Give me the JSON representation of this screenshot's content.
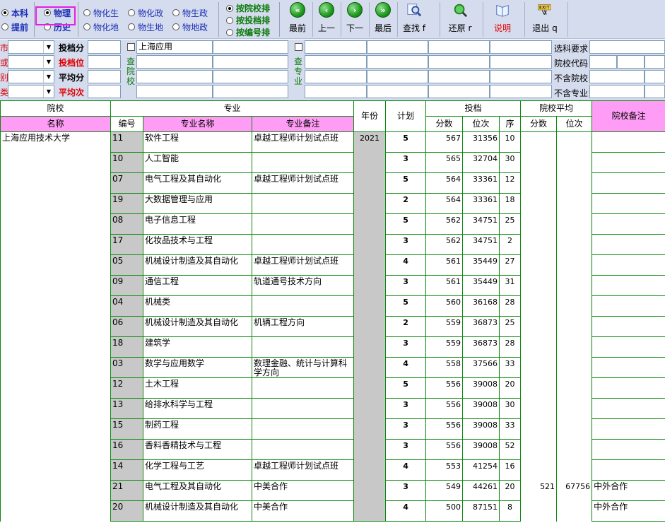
{
  "toolbar": {
    "batch": [
      {
        "label": "本科",
        "checked": true
      },
      {
        "label": "提前",
        "checked": false
      }
    ],
    "subject": [
      {
        "label": "物理",
        "checked": true
      },
      {
        "label": "历史",
        "checked": false
      }
    ],
    "combos": [
      {
        "label": "物化生",
        "checked": false
      },
      {
        "label": "物化地",
        "checked": false
      },
      {
        "label": "物化政",
        "checked": false
      },
      {
        "label": "物生地",
        "checked": false
      },
      {
        "label": "物生政",
        "checked": false
      },
      {
        "label": "物地政",
        "checked": false
      }
    ],
    "sort": [
      {
        "label": "按院校排",
        "checked": true
      },
      {
        "label": "按投档排",
        "checked": false
      },
      {
        "label": "按编号排",
        "checked": false
      }
    ],
    "buttons": {
      "first": "最前",
      "prev": "上一",
      "next": "下一",
      "last": "最后",
      "find": "查找 f",
      "restore": "还原 r",
      "help": "说明",
      "exit": "退出 q"
    }
  },
  "filter": {
    "left_labels": [
      "市",
      "或",
      "别",
      "类"
    ],
    "score_labels": [
      "投档分",
      "投档位",
      "平均分",
      "平均次"
    ],
    "school_query_label": "查院校",
    "major_query_label": "查专业",
    "school_query_value": "上海应用",
    "right_labels": [
      "选科要求",
      "院校代码",
      "不含院校",
      "不含专业"
    ]
  },
  "table": {
    "headers": {
      "school_group": "院校",
      "school_name": "名称",
      "major_group": "专业",
      "code": "编号",
      "major_name": "专业名称",
      "major_note": "专业备注",
      "year": "年份",
      "plan": "计划",
      "toudang": "投档",
      "score": "分数",
      "rank": "位次",
      "order": "序",
      "school_avg": "院校平均",
      "avg_score": "分数",
      "avg_rank": "位次",
      "school_note": "院校备注"
    },
    "school_name": "上海应用技术大学",
    "year": "2021",
    "rows": [
      {
        "code": "11",
        "name": "软件工程",
        "note": "卓越工程师计划试点班",
        "plan": "5",
        "score": "567",
        "rank": "31356",
        "order": "10",
        "avg_score": "",
        "avg_rank": "",
        "school_note": ""
      },
      {
        "code": "10",
        "name": "人工智能",
        "note": "",
        "plan": "3",
        "score": "565",
        "rank": "32704",
        "order": "30",
        "avg_score": "",
        "avg_rank": "",
        "school_note": ""
      },
      {
        "code": "07",
        "name": "电气工程及其自动化",
        "note": "卓越工程师计划试点班",
        "plan": "5",
        "score": "564",
        "rank": "33361",
        "order": "12",
        "avg_score": "",
        "avg_rank": "",
        "school_note": ""
      },
      {
        "code": "19",
        "name": "大数据管理与应用",
        "note": "",
        "plan": "2",
        "score": "564",
        "rank": "33361",
        "order": "18",
        "avg_score": "",
        "avg_rank": "",
        "school_note": ""
      },
      {
        "code": "08",
        "name": "电子信息工程",
        "note": "",
        "plan": "5",
        "score": "562",
        "rank": "34751",
        "order": "25",
        "avg_score": "",
        "avg_rank": "",
        "school_note": ""
      },
      {
        "code": "17",
        "name": "化妆品技术与工程",
        "note": "",
        "plan": "3",
        "score": "562",
        "rank": "34751",
        "order": "2",
        "avg_score": "",
        "avg_rank": "",
        "school_note": ""
      },
      {
        "code": "05",
        "name": "机械设计制造及其自动化",
        "note": "卓越工程师计划试点班",
        "plan": "4",
        "score": "561",
        "rank": "35449",
        "order": "27",
        "avg_score": "",
        "avg_rank": "",
        "school_note": ""
      },
      {
        "code": "09",
        "name": "通信工程",
        "note": "轨道通号技术方向",
        "plan": "3",
        "score": "561",
        "rank": "35449",
        "order": "31",
        "avg_score": "",
        "avg_rank": "",
        "school_note": ""
      },
      {
        "code": "04",
        "name": "机械类",
        "note": "",
        "plan": "5",
        "score": "560",
        "rank": "36168",
        "order": "28",
        "avg_score": "",
        "avg_rank": "",
        "school_note": ""
      },
      {
        "code": "06",
        "name": "机械设计制造及其自动化",
        "note": "机辆工程方向",
        "plan": "2",
        "score": "559",
        "rank": "36873",
        "order": "25",
        "avg_score": "",
        "avg_rank": "",
        "school_note": ""
      },
      {
        "code": "18",
        "name": "建筑学",
        "note": "",
        "plan": "3",
        "score": "559",
        "rank": "36873",
        "order": "28",
        "avg_score": "",
        "avg_rank": "",
        "school_note": ""
      },
      {
        "code": "03",
        "name": "数学与应用数学",
        "note": "数理金融、统计与计算科学方向",
        "plan": "4",
        "score": "558",
        "rank": "37566",
        "order": "33",
        "avg_score": "",
        "avg_rank": "",
        "school_note": ""
      },
      {
        "code": "12",
        "name": "土木工程",
        "note": "",
        "plan": "5",
        "score": "556",
        "rank": "39008",
        "order": "20",
        "avg_score": "",
        "avg_rank": "",
        "school_note": ""
      },
      {
        "code": "13",
        "name": "给排水科学与工程",
        "note": "",
        "plan": "3",
        "score": "556",
        "rank": "39008",
        "order": "30",
        "avg_score": "",
        "avg_rank": "",
        "school_note": ""
      },
      {
        "code": "15",
        "name": "制药工程",
        "note": "",
        "plan": "3",
        "score": "556",
        "rank": "39008",
        "order": "33",
        "avg_score": "",
        "avg_rank": "",
        "school_note": ""
      },
      {
        "code": "16",
        "name": "香料香精技术与工程",
        "note": "",
        "plan": "3",
        "score": "556",
        "rank": "39008",
        "order": "52",
        "avg_score": "",
        "avg_rank": "",
        "school_note": ""
      },
      {
        "code": "14",
        "name": "化学工程与工艺",
        "note": "卓越工程师计划试点班",
        "plan": "4",
        "score": "553",
        "rank": "41254",
        "order": "16",
        "avg_score": "",
        "avg_rank": "",
        "school_note": ""
      },
      {
        "code": "21",
        "name": "电气工程及其自动化",
        "note": "中美合作",
        "plan": "3",
        "score": "549",
        "rank": "44261",
        "order": "20",
        "avg_score": "521",
        "avg_rank": "67756",
        "school_note": "中外合作"
      },
      {
        "code": "20",
        "name": "机械设计制造及其自动化",
        "note": "中美合作",
        "plan": "4",
        "score": "500",
        "rank": "87151",
        "order": "8",
        "avg_score": "",
        "avg_rank": "",
        "school_note": "中外合作"
      }
    ]
  },
  "colors": {
    "toolbar_bg": "#d5dcee",
    "header_pink": "#ff9cf5",
    "grid_green": "#0a8a0a",
    "code_gray": "#c8c8c8",
    "highlight": "#e81ee0"
  }
}
